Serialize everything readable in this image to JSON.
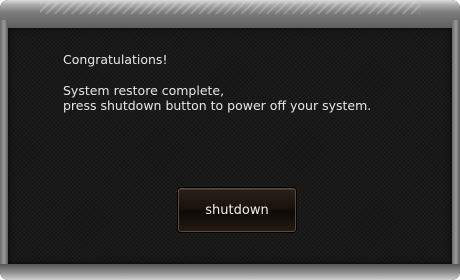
{
  "dialog": {
    "message_title": "Congratulations!",
    "message_line1": "System restore complete,",
    "message_line2": "press shutdown button to power off your system.",
    "shutdown_label": "shutdown"
  },
  "colors": {
    "panel_background": "#151515",
    "text": "#e6e6e6",
    "button_background": "#1a120d",
    "button_border": "#5a4a3c"
  }
}
